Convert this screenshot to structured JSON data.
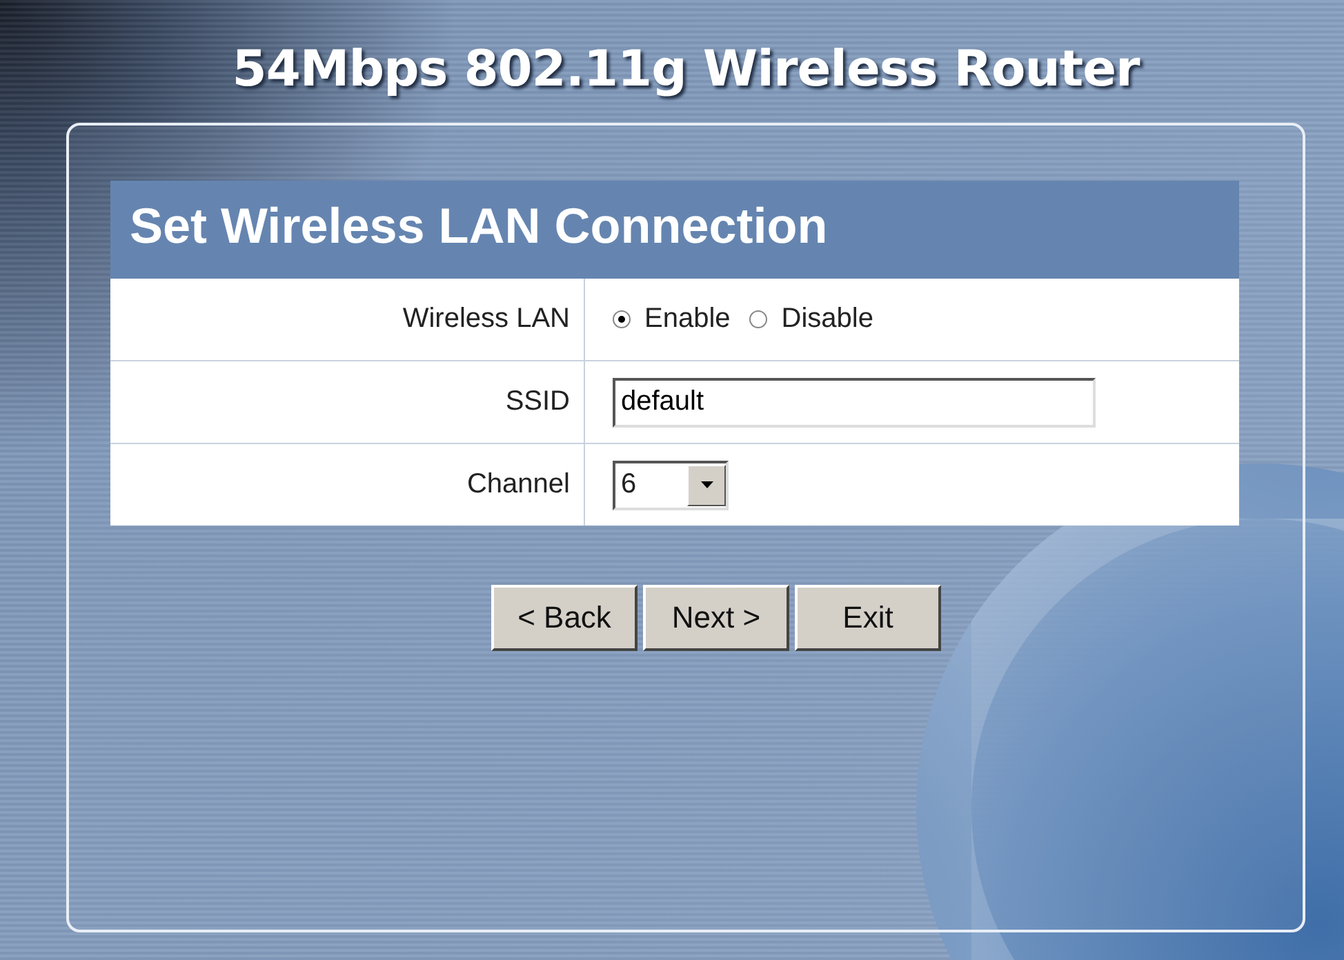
{
  "title": "54Mbps 802.11g Wireless Router",
  "panel": {
    "heading": "Set Wireless LAN Connection",
    "rows": [
      {
        "kind": "radio",
        "label": "Wireless LAN",
        "options": [
          {
            "label": "Enable",
            "selected": true
          },
          {
            "label": "Disable",
            "selected": false
          }
        ]
      },
      {
        "kind": "text",
        "label": "SSID",
        "value": "default"
      },
      {
        "kind": "select",
        "label": "Channel",
        "value": "6"
      }
    ],
    "buttons": [
      "< Back",
      "Next >",
      "Exit"
    ]
  }
}
